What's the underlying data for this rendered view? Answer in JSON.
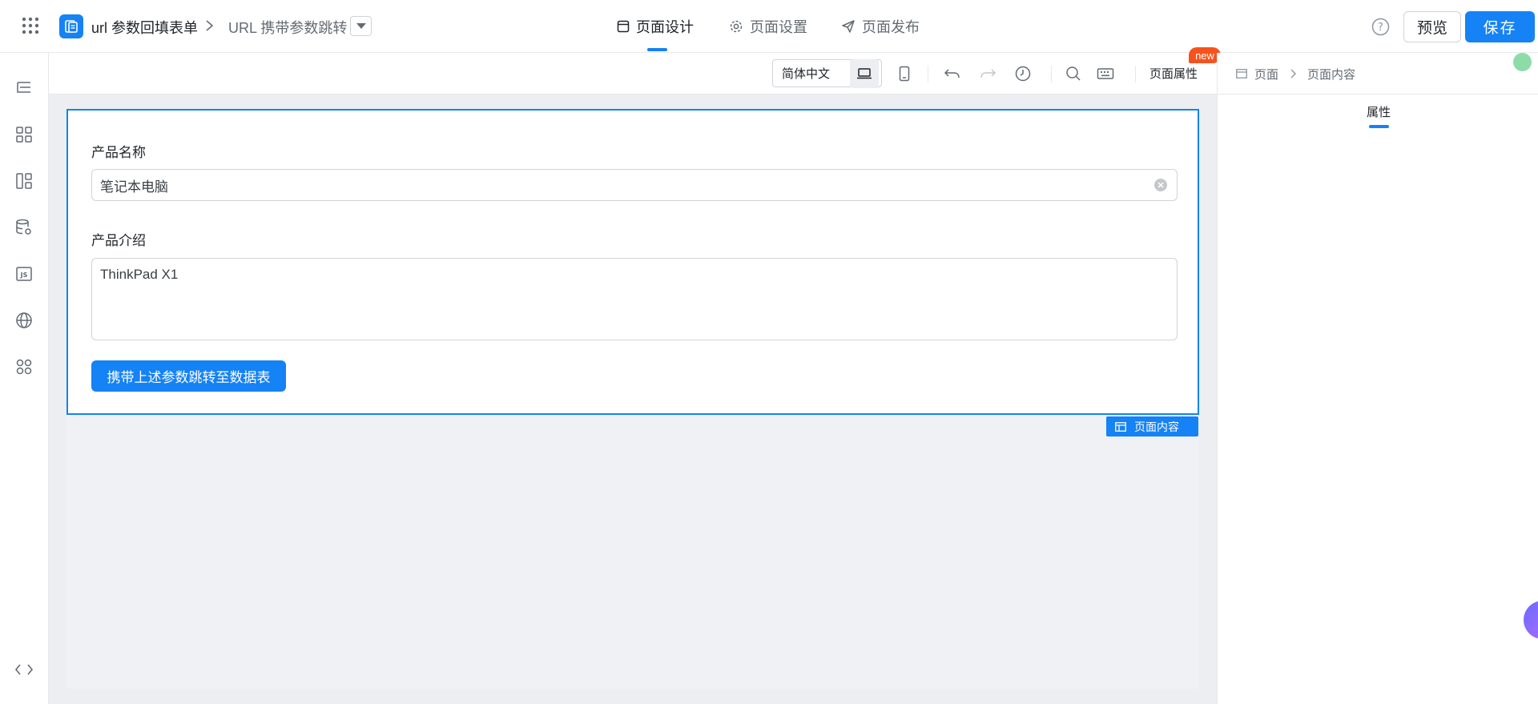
{
  "header": {
    "app_name": "url 参数回填表单",
    "page_name": "URL 携带参数跳转",
    "tabs": [
      {
        "label": "页面设计",
        "icon": "layout-icon",
        "active": true
      },
      {
        "label": "页面设置",
        "icon": "gear-icon",
        "active": false
      },
      {
        "label": "页面发布",
        "icon": "send-icon",
        "active": false
      }
    ],
    "preview_label": "预览",
    "save_label": "保存",
    "accent_color": "#1582f5"
  },
  "sidebar": {
    "items": [
      {
        "icon": "outline-tree-icon"
      },
      {
        "icon": "components-grid-icon"
      },
      {
        "icon": "layout-templates-icon"
      },
      {
        "icon": "data-source-icon"
      },
      {
        "icon": "js-action-icon"
      },
      {
        "icon": "globe-icon"
      },
      {
        "icon": "plugins-icon"
      },
      {
        "icon": "code-source-icon"
      }
    ]
  },
  "toolbar": {
    "language": "简体中文",
    "page_props_label": "页面属性",
    "new_badge": "new"
  },
  "canvas": {
    "form": {
      "product_name_label": "产品名称",
      "product_name_value": "笔记本电脑",
      "product_intro_label": "产品介绍",
      "product_intro_value": "ThinkPad X1",
      "jump_button_label": "携带上述参数跳转至数据表"
    },
    "content_tag": "页面内容"
  },
  "right_panel": {
    "breadcrumb": [
      "页面",
      "页面内容"
    ],
    "tab": "属性"
  }
}
